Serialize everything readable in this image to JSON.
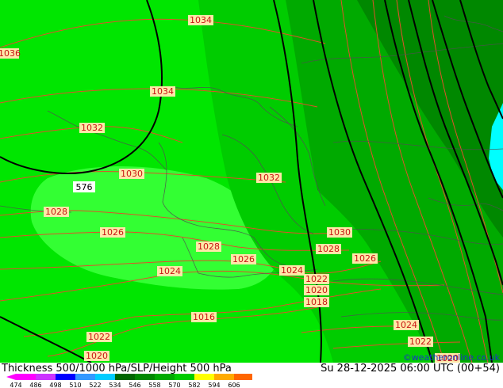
{
  "title": "Thickness 500/1000 hPa/SLP/Height 500 hPa",
  "datetime": "Su 28-12-2025 06:00 UTC (00+54)",
  "credit": "©weatheronline.co.uk",
  "legend": {
    "values": [
      "474",
      "486",
      "498",
      "510",
      "522",
      "534",
      "546",
      "558",
      "570",
      "582",
      "594",
      "606"
    ],
    "colors": [
      "#ff00ff",
      "#cc33ff",
      "#0000ff",
      "#3399ff",
      "#00ccff",
      "#006600",
      "#008800",
      "#00aa00",
      "#00cc00",
      "#ffff00",
      "#ffaa00",
      "#ff6600"
    ]
  },
  "map": {
    "colors": {
      "bright_green": "#00e600",
      "light_green": "#33ff33",
      "mid_green": "#00cc00",
      "dark_green": "#00aa00",
      "darker_green": "#008800",
      "cyan": "#00ffff",
      "isobar": "#e0502a",
      "height_contour": "#000000",
      "border": "#505050"
    },
    "isobar_labels": [
      "1036",
      "1034",
      "1034",
      "1032",
      "1030",
      "1032",
      "1028",
      "1026",
      "1028",
      "1030",
      "1028",
      "1026",
      "1026",
      "1024",
      "1024",
      "1022",
      "1020",
      "1018",
      "1016",
      "1022",
      "1020",
      "1024",
      "1022",
      "1020"
    ],
    "height_labels": [
      "576"
    ]
  }
}
